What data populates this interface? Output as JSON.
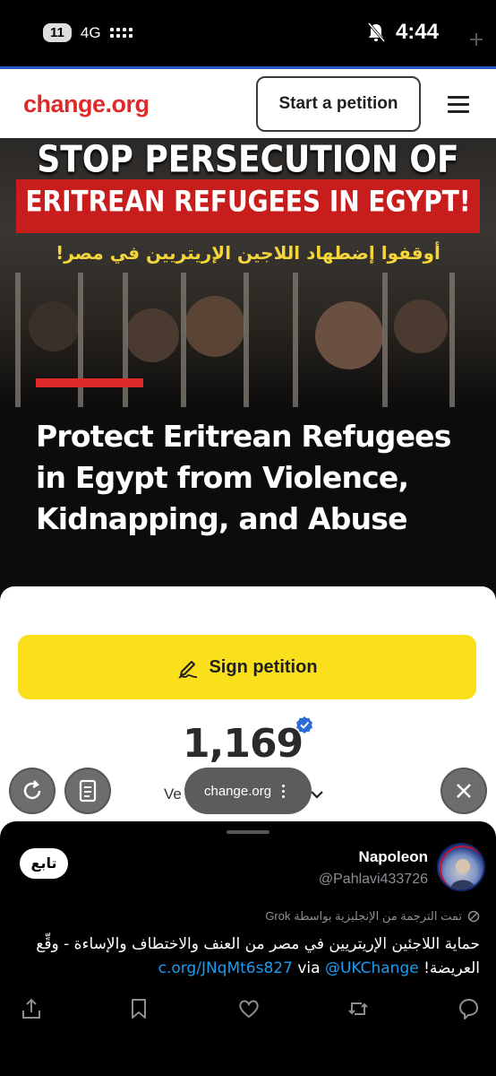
{
  "status_bar": {
    "battery": "11",
    "network": "4G",
    "time": "4:44"
  },
  "site": {
    "logo": "change.org",
    "start_button": "Start a petition"
  },
  "hero": {
    "banner_line1": "STOP PERSECUTION OF",
    "banner_line2": "ERITREAN REFUGEES IN EGYPT!",
    "banner_arabic": "أوقفوا إضطهاد اللاجين الإريتريين في مصر!",
    "headline": "Protect Eritrean Refugees in Egypt from Violence, Kidnapping, and Abuse"
  },
  "petition": {
    "sign_label": "Sign petition",
    "signatures": "1,169",
    "verified_label": "Ve"
  },
  "browser": {
    "url": "change.org"
  },
  "tweet": {
    "follow_label": "تابع",
    "user_name": "Napoleon",
    "user_handle": "@Pahlavi433726",
    "translated_note": "تمت الترجمة من الإنجليزية بواسطة Grok",
    "text_main": "حماية اللاجئين الإريتريين في مصر من العنف والاختطاف والإساءة - وقِّع العريضة!",
    "link_short": "c.org/JNqMt6s827",
    "via_word": "via",
    "mention": "@UKChange"
  },
  "colors": {
    "brand_red": "#e02a2a",
    "sign_yellow": "#f9e01b",
    "link_blue": "#1d9bf0"
  }
}
